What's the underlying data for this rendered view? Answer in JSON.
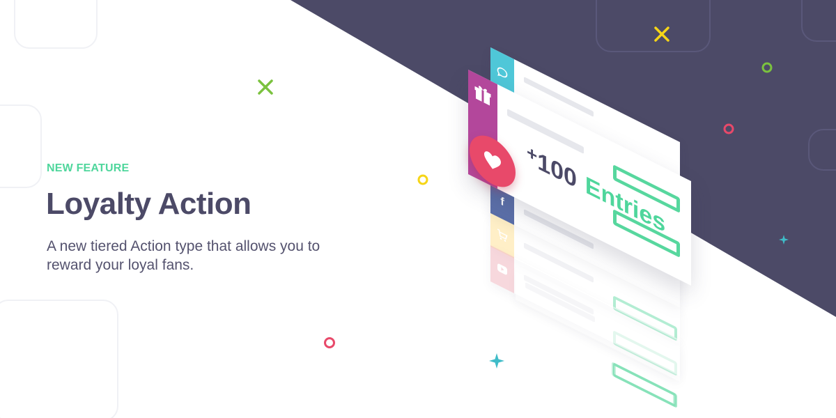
{
  "hero": {
    "eyebrow": "NEW FEATURE",
    "title": "Loyalty Action",
    "description": "A new tiered Action type that allows you to reward your loyal fans."
  },
  "illustration": {
    "entries_plus": "+",
    "entries_value": "100",
    "entries_label": "Entries",
    "icons": [
      "chat-icon",
      "gift-icon",
      "heart-icon",
      "facebook-icon",
      "cart-icon",
      "youtube-icon"
    ],
    "facebook_glyph": "f"
  },
  "colors": {
    "dark": "#4c4a67",
    "accent_green": "#4fd69c",
    "cyan": "#4fc7d8",
    "purple": "#b3479b",
    "red": "#e8496a",
    "facebook_blue": "#5b6fa8",
    "cart_yellow": "#ffe39a",
    "youtube_pink": "#f2b9c2",
    "confetti_yellow": "#f6d517",
    "confetti_green": "#7bc23f",
    "confetti_teal": "#3fbcc8"
  }
}
